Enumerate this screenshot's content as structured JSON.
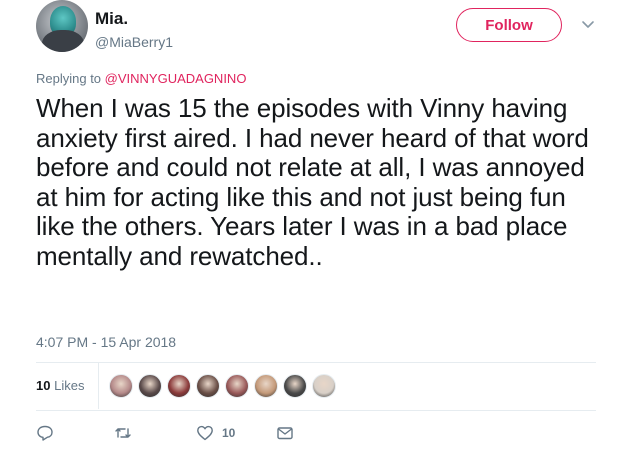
{
  "user": {
    "display_name": "Mia.",
    "handle": "@MiaBerry1",
    "avatar_icon": "profile-photo"
  },
  "follow_label": "Follow",
  "menu_icon": "chevron-down-icon",
  "reply_context": {
    "prefix": "Replying to ",
    "mention": "@VINNYGUADAGNINO"
  },
  "tweet_text": "When I was 15 the episodes with Vinny having anxiety first aired. I had never heard of that word before and could not relate at all, I was annoyed at him for acting like this and not just being fun like the others. Years later I was in a bad place mentally and rewatched..",
  "timestamp": "4:07 PM - 15 Apr 2018",
  "likes": {
    "count": "10",
    "label": "Likes"
  },
  "likers": [
    {
      "name": "liker-avatar-1",
      "color": "#b58a8a"
    },
    {
      "name": "liker-avatar-2",
      "color": "#5a4a4a"
    },
    {
      "name": "liker-avatar-3",
      "color": "#8c3b3b"
    },
    {
      "name": "liker-avatar-4",
      "color": "#6b5048"
    },
    {
      "name": "liker-avatar-5",
      "color": "#9a5a5a"
    },
    {
      "name": "liker-avatar-6",
      "color": "#c49a7a"
    },
    {
      "name": "liker-avatar-7",
      "color": "#4a4a4a"
    },
    {
      "name": "liker-avatar-8",
      "color": "#d8d0c8"
    }
  ],
  "actions": {
    "reply_icon": "reply-icon",
    "retweet_icon": "retweet-icon",
    "like_icon": "heart-icon",
    "like_count": "10",
    "dm_icon": "envelope-icon"
  },
  "colors": {
    "accent": "#e0245e",
    "muted": "#657786",
    "text": "#14171a",
    "border": "#e6ecf0"
  }
}
